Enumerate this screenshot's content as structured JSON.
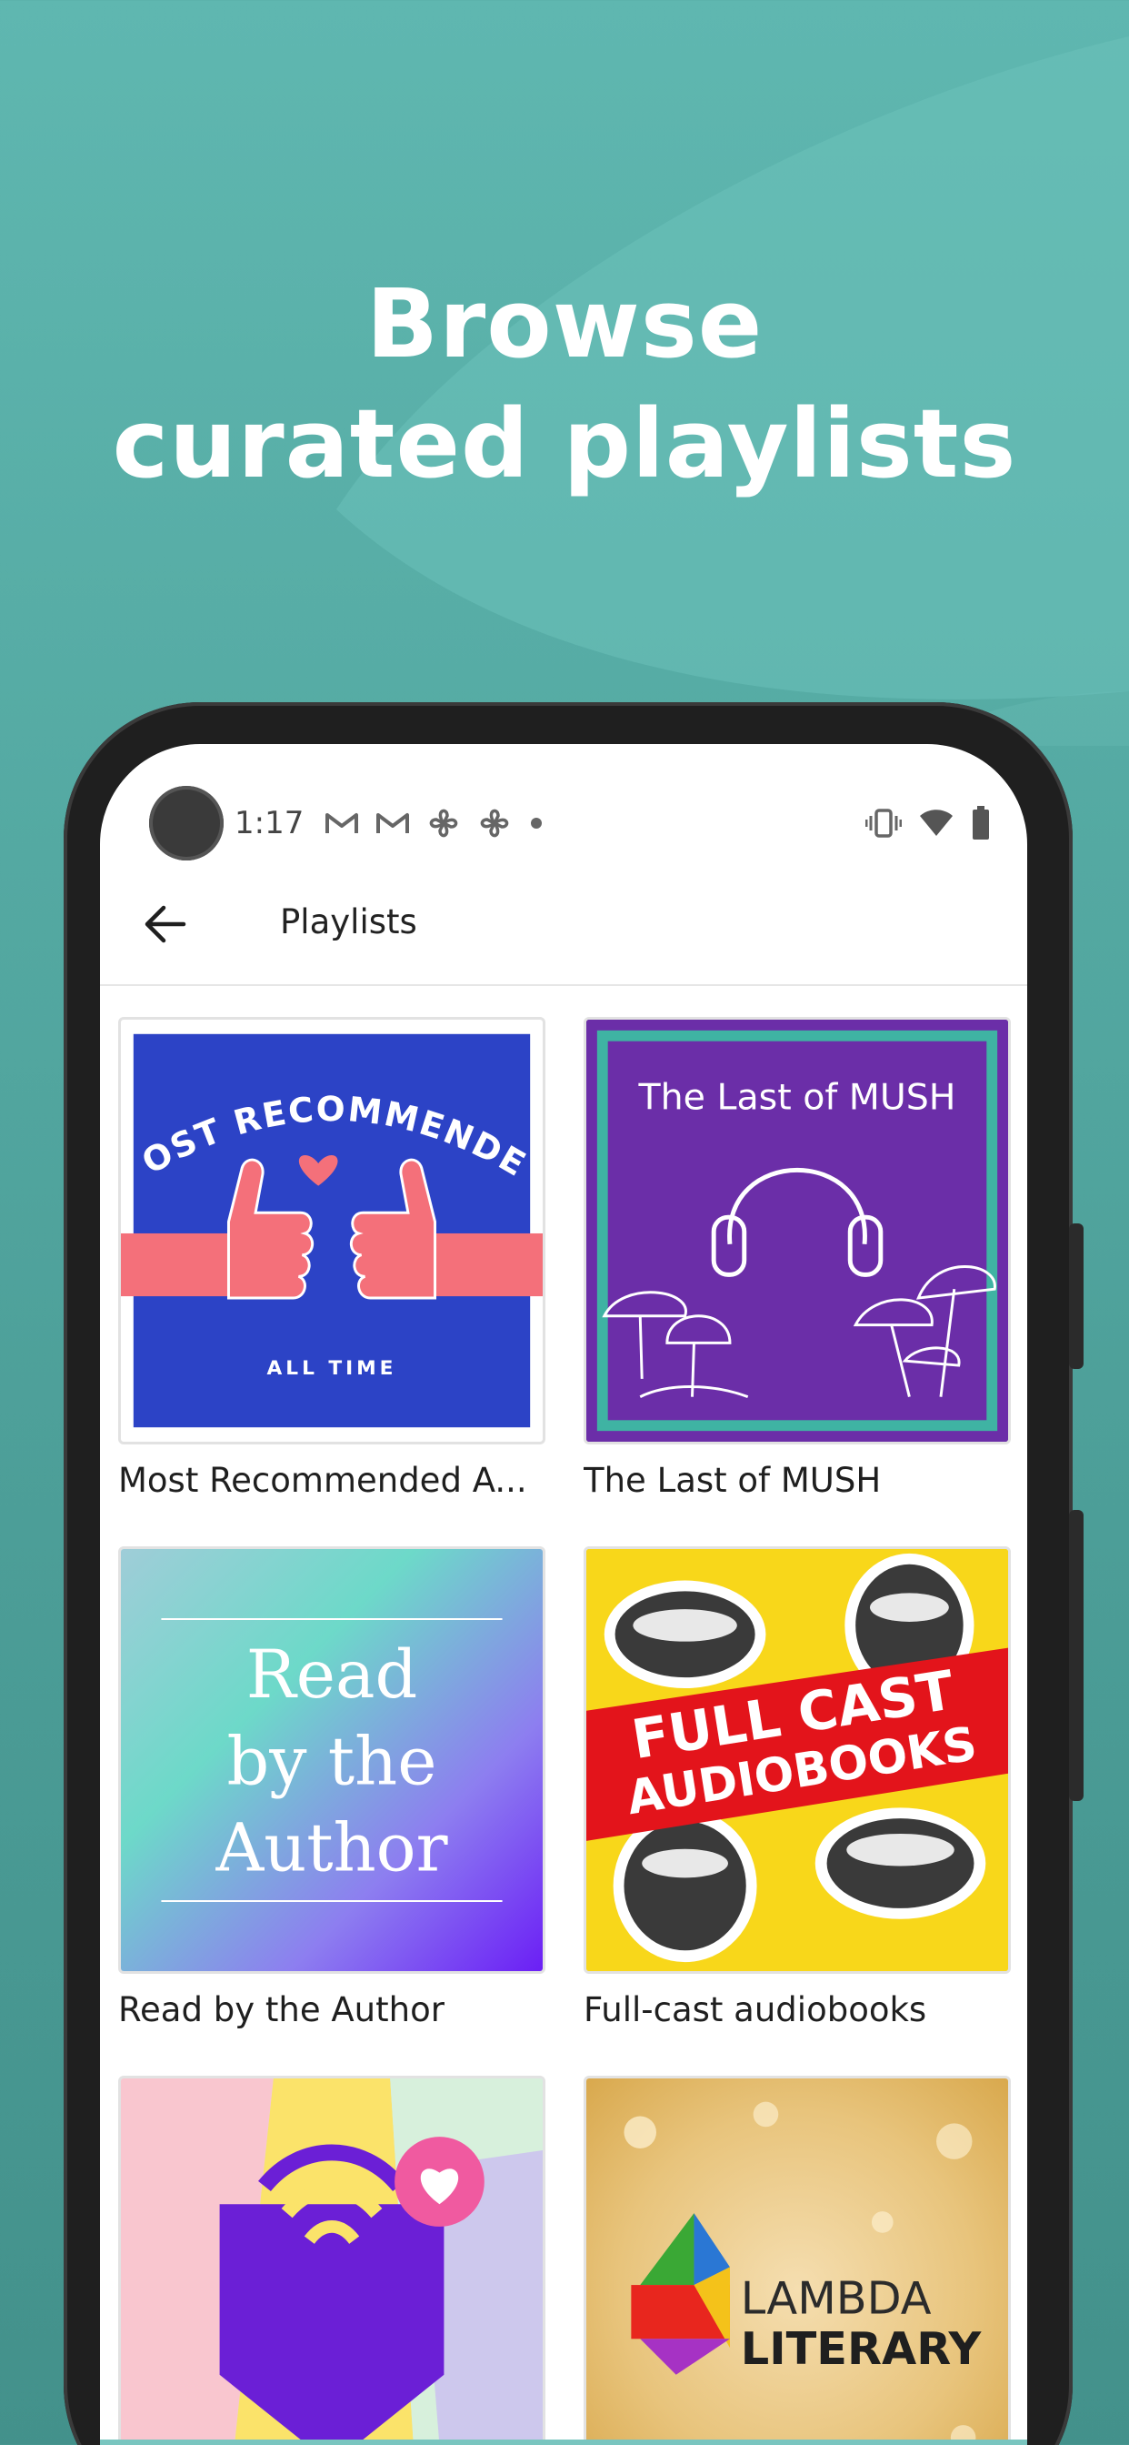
{
  "headline": {
    "line1": "Browse",
    "line2": "curated playlists"
  },
  "status_bar": {
    "time": "1:17",
    "left_icons": [
      "gmail-icon",
      "gmail-icon",
      "pinwheel-icon",
      "pinwheel-icon",
      "dot-icon"
    ],
    "right_icons": [
      "vibrate-icon",
      "wifi-icon",
      "battery-icon"
    ]
  },
  "app_bar": {
    "title": "Playlists",
    "back_icon": "arrow-left-icon"
  },
  "playlists": [
    {
      "label": "Most Recommended A...",
      "cover_text_top": "MOST RECOMMENDED",
      "cover_text_bottom": "ALL TIME"
    },
    {
      "label": "The Last of MUSH",
      "cover_text_top": "The Last of MUSH"
    },
    {
      "label": "Read by the Author",
      "cover_text_1": "Read",
      "cover_text_2": "by the",
      "cover_text_3": "Author"
    },
    {
      "label": "Full-cast audiobooks",
      "cover_text_1": "FULL CAST",
      "cover_text_2": "AUDIOBOOKS"
    },
    {
      "label": ""
    },
    {
      "label": "",
      "cover_text_1": "LAMBDA",
      "cover_text_2": "LITERARY"
    }
  ],
  "colors": {
    "background": "#54a9a2",
    "headline": "#ffffff",
    "screen": "#ffffff"
  }
}
